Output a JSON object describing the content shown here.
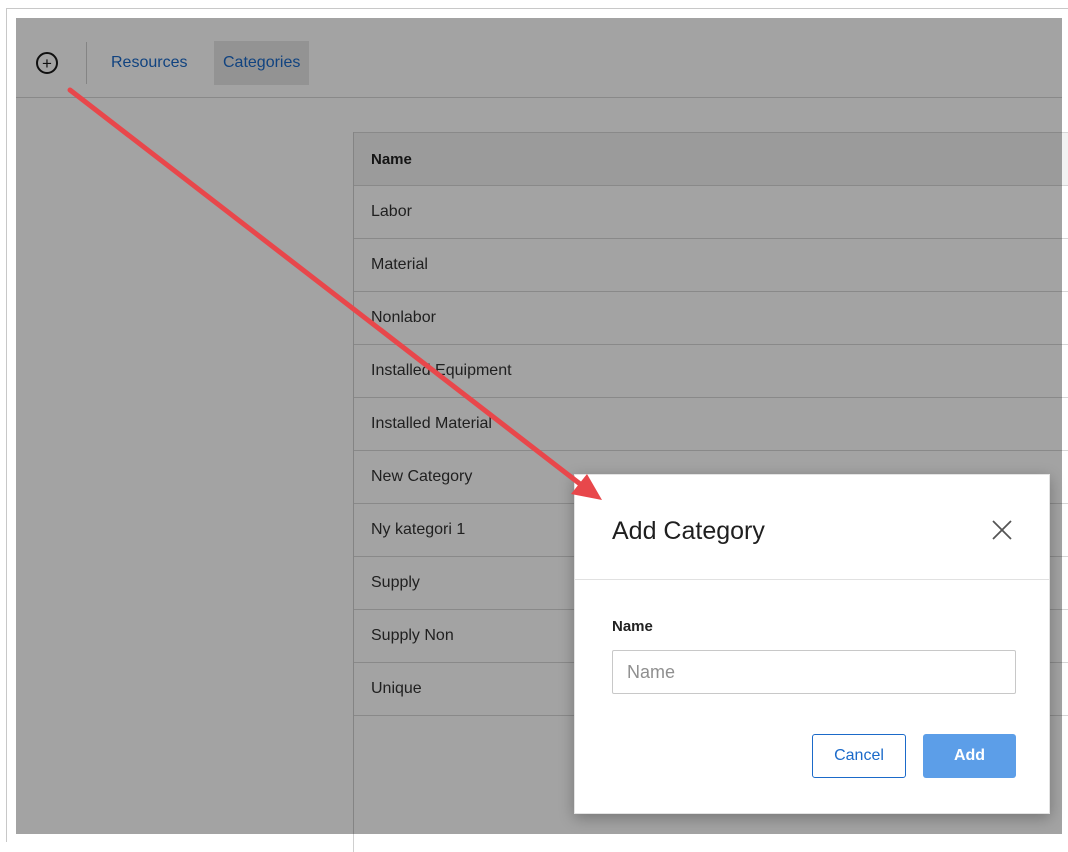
{
  "toolbar": {
    "add_icon": "plus-circle-icon",
    "tabs": [
      {
        "label": "Resources",
        "active": false
      },
      {
        "label": "Categories",
        "active": true
      }
    ]
  },
  "table": {
    "header": "Name",
    "rows": [
      "Labor",
      "Material",
      "Nonlabor",
      "Installed Equipment",
      "Installed Material",
      "New Category",
      "Ny kategori 1",
      "Supply",
      "Supply Non",
      "Unique"
    ]
  },
  "modal": {
    "title": "Add Category",
    "close_icon": "close-icon",
    "field_label": "Name",
    "input_placeholder": "Name",
    "input_value": "",
    "cancel_label": "Cancel",
    "add_label": "Add"
  },
  "colors": {
    "link": "#1b6ac9",
    "primary_button": "#5c9ee8",
    "annotation_arrow": "#e8474b"
  }
}
